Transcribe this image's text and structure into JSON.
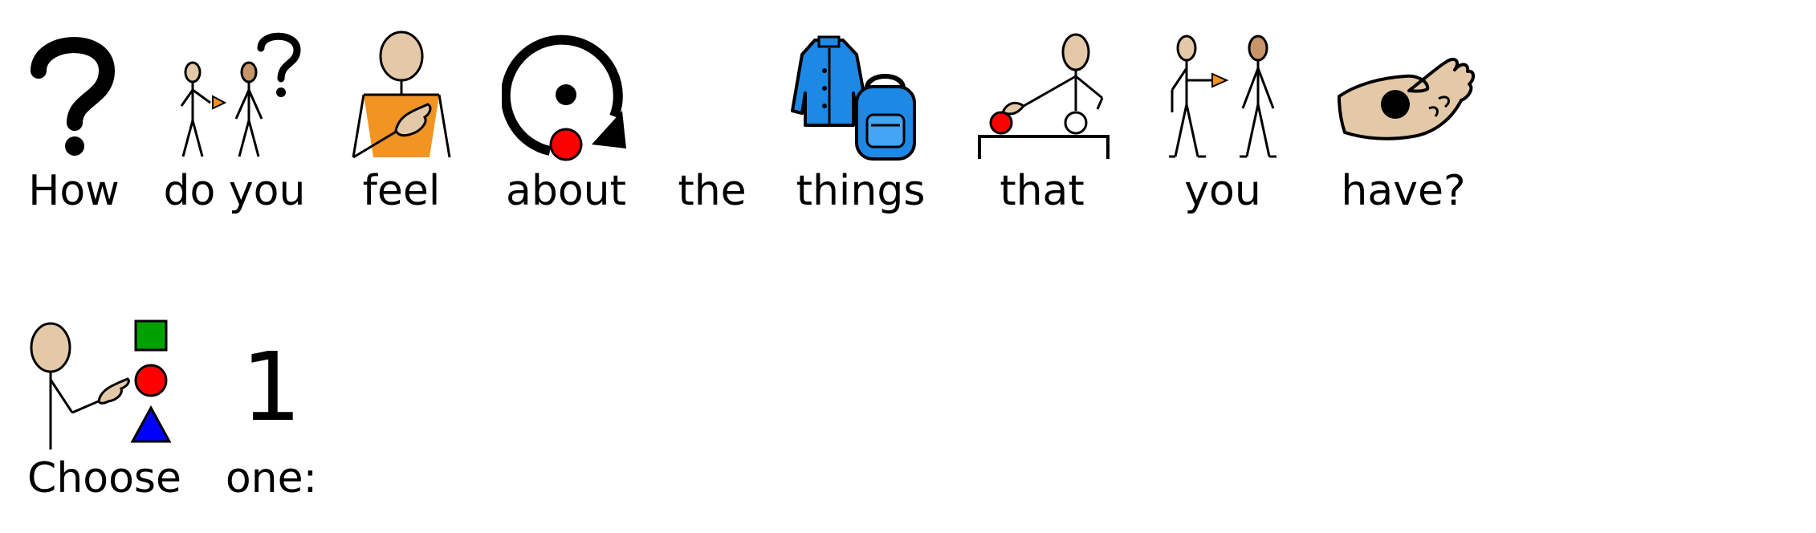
{
  "sentence1": {
    "words": [
      "How",
      "do you",
      "feel",
      "about",
      "the",
      "things",
      "that",
      "you",
      "have?"
    ]
  },
  "sentence2": {
    "words": [
      "Choose",
      "one:"
    ],
    "number_symbol": "1"
  },
  "icons": {
    "question": "question-mark-icon",
    "do_you": "person-asking-icon",
    "feel": "person-hand-on-chest-icon",
    "about": "circle-arrow-dot-icon",
    "things": "coat-and-backpack-icon",
    "that": "pointing-at-object-icon",
    "you": "person-pointing-at-person-icon",
    "have": "open-hand-holding-ball-icon",
    "choose": "person-choosing-shapes-icon"
  },
  "colors": {
    "skin": "#e4c9a8",
    "skin_dark": "#c8946a",
    "orange": "#f29423",
    "red": "#ff0000",
    "green": "#00a000",
    "blue": "#0000ff",
    "coat_blue": "#1e88e5"
  }
}
